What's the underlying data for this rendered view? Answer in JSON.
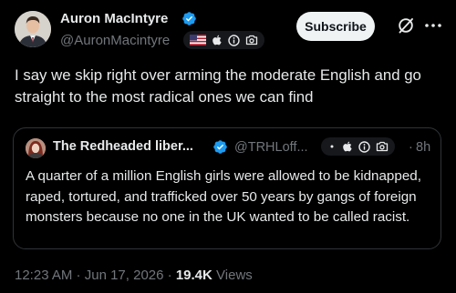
{
  "author": {
    "name": "Auron MacIntyre",
    "handle": "@AuronMacintyre"
  },
  "subscribe_label": "Subscribe",
  "tweet": {
    "text": "I say we skip right over arming the moderate English and go straight to the most radical ones we can find"
  },
  "quote": {
    "name": "The Redheaded liber...",
    "handle": "@TRHLoff...",
    "separator": "·",
    "time": "8h",
    "text": "A quarter of a million English girls were allowed to be kidnapped, raped, tortured, and trafficked over 50 years by gangs of foreign monsters because no one in the UK wanted to be called racist."
  },
  "meta": {
    "time": "12:23 AM",
    "separator": " · ",
    "date": "Jun 17, 2026",
    "views_count": "19.4K",
    "views_label": "Views"
  },
  "colors": {
    "background": "#000000",
    "text_primary": "#e7e9ea",
    "text_secondary": "#71767b",
    "verified_blue": "#1d9bf0",
    "border": "#2f3336",
    "button_bg": "#eff3f4"
  },
  "icons": {
    "verified": "verified-badge-icon",
    "flag": "us-flag-icon",
    "apple": "apple-icon",
    "info": "info-icon",
    "camera": "camera-icon",
    "grok": "grok-icon",
    "more": "more-icon"
  }
}
